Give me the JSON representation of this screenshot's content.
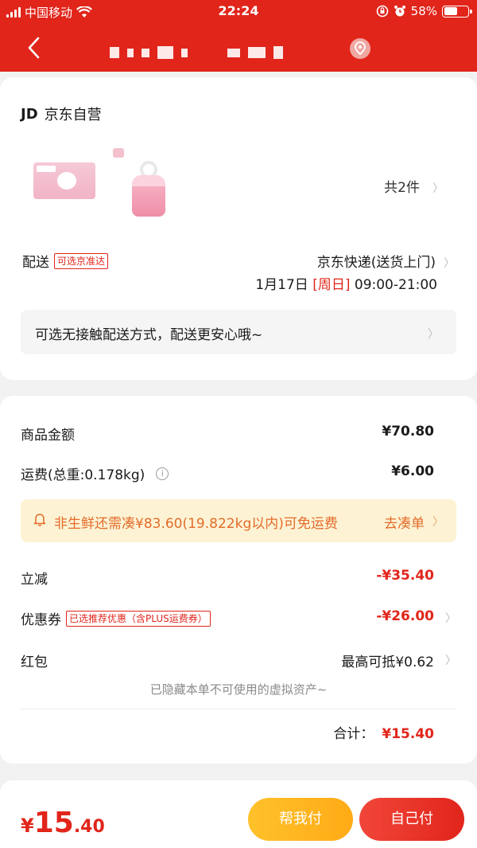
{
  "status_bar": {
    "carrier": "中国移动",
    "time": "22:24",
    "battery": "58%",
    "battery_level": 0.58
  },
  "header": {
    "back_icon": "chevron-left-icon",
    "location_icon": "location-pin-icon"
  },
  "store": {
    "logo": "JD",
    "name": "京东自营"
  },
  "products": {
    "count_label": "共2件"
  },
  "delivery": {
    "label": "配送",
    "tag": "可选京准达",
    "method": "京东快递(送货上门)",
    "date": "1月17日",
    "weekday": "[周日]",
    "time_window": "09:00-21:00",
    "notice": "可选无接触配送方式，配送更安心哦~"
  },
  "summary": {
    "goods_label": "商品金额",
    "goods_value": "¥70.80",
    "freight_label": "运费(总重:0.178kg)",
    "freight_value": "¥6.00",
    "freight_tip": "非生鲜还需凑¥83.60(19.822kg以内)可免运费",
    "freight_tip_action": "去凑单",
    "discount_label": "立减",
    "discount_value": "-¥35.40",
    "coupon_label": "优惠券",
    "coupon_tag": "已选推荐优惠（含PLUS运费券）",
    "coupon_value": "-¥26.00",
    "redpacket_label": "红包",
    "redpacket_value": "最高可抵¥0.62",
    "hidden_note": "已隐藏本单不可使用的虚拟资产~",
    "total_label": "合计：",
    "total_value": "¥15.40"
  },
  "footer": {
    "currency": "¥",
    "amount_int": "15",
    "amount_dec": ".40",
    "friend_pay_label": "帮我付",
    "self_pay_label": "自己付"
  },
  "colors": {
    "brand_red": "#e1251b",
    "friend_yellow": "#ffb81f",
    "tip_bg": "#fdf3d4"
  }
}
